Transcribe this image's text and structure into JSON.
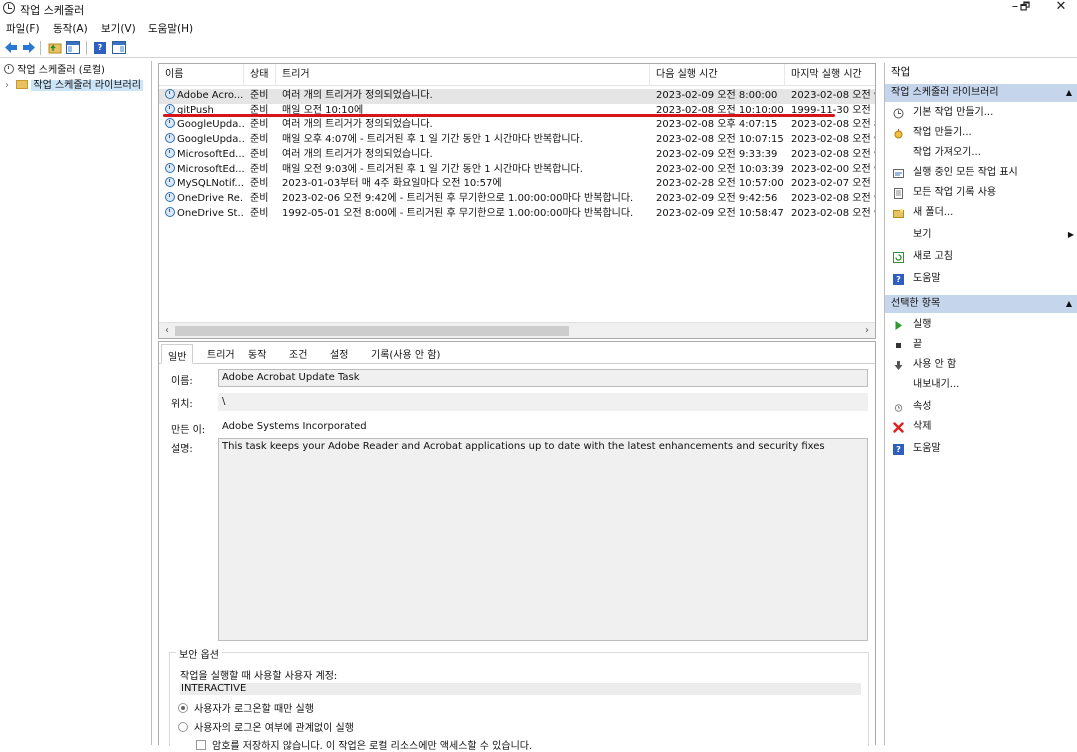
{
  "window": {
    "title": "작업 스케줄러",
    "minimize": "–",
    "maximize": "🗗",
    "close": "✕"
  },
  "menu": [
    "파일(F)",
    "동작(A)",
    "보기(V)",
    "도움말(H)"
  ],
  "tree": {
    "root": "작업 스케줄러 (로컬)",
    "child": "작업 스케줄러 라이브러리"
  },
  "grid": {
    "columns": [
      "이름",
      "상태",
      "트리거",
      "다음 실행 시간",
      "마지막 실행 시간"
    ],
    "rows": [
      [
        "Adobe Acro...",
        "준비",
        "여러 개의 트리거가 정의되었습니다.",
        "2023-02-09 오전 8:00:00",
        "2023-02-08 오전 9:"
      ],
      [
        "gitPush",
        "준비",
        "매일 오전 10:10에",
        "2023-02-08 오전 10:10:00",
        "1999-11-30 오전 1"
      ],
      [
        "GoogleUpda...",
        "준비",
        "여러 개의 트리거가 정의되었습니다.",
        "2023-02-08 오후 4:07:15",
        "2023-02-08 오전 8"
      ],
      [
        "GoogleUpda...",
        "준비",
        "매일 오후 4:07에 - 트리거된 후 1 일 기간 동안 1 시간마다 반복합니다.",
        "2023-02-08 오전 10:07:15",
        "2023-02-08 오전 9"
      ],
      [
        "MicrosoftEd...",
        "준비",
        "여러 개의 트리거가 정의되었습니다.",
        "2023-02-09 오전 9:33:39",
        "2023-02-08 오전 9"
      ],
      [
        "MicrosoftEd...",
        "준비",
        "매일 오전 9:03에 - 트리거된 후 1 일 기간 동안 1 시간마다 반복합니다.",
        "2023-02-00 오전 10:03:39",
        "2023-02-00 오전 9"
      ],
      [
        "MySQLNotif...",
        "준비",
        "2023-01-03부터 매 4주 화요일마다 오전 10:57에",
        "2023-02-28 오전 10:57:00",
        "2023-02-07 오전 1"
      ],
      [
        "OneDrive Re...",
        "준비",
        "2023-02-06 오전 9:42에 - 트리거된 후 무기한으로 1.00:00:00마다 반복합니다.",
        "2023-02-09 오전 9:42:56",
        "2023-02-08 오전 9"
      ],
      [
        "OneDrive St...",
        "준비",
        "1992-05-01 오전 8:00에 - 트리거된 후 무기한으로 1.00:00:00마다 반복합니다.",
        "2023-02-09 오전 10:58:47",
        "2023-02-08 오전 9"
      ]
    ]
  },
  "details": {
    "tabs": [
      "일반",
      "트리거",
      "동작",
      "조건",
      "설정",
      "기록(사용 안 함)"
    ],
    "name_label": "이름:",
    "name_value": "Adobe Acrobat Update Task",
    "location_label": "위치:",
    "location_value": "\\",
    "author_label": "만든 이:",
    "author_value": "Adobe Systems Incorporated",
    "desc_label": "설명:",
    "desc_value": "This task keeps your Adobe Reader and Acrobat applications up to date with the latest enhancements and security fixes",
    "security_title": "보안 옵션",
    "account_label": "작업을 실행할 때 사용할 사용자 계정:",
    "account_value": "INTERACTIVE",
    "radio1": "사용자가 로그온할 때만 실행",
    "radio2": "사용자의 로그온 여부에 관계없이 실행",
    "check1": "암호를 저장하지 않습니다. 이 작업은 로컬 리소스에만 액세스할 수 있습니다."
  },
  "actions": {
    "header": "작업",
    "section1": "작업 스케줄러 라이브러리",
    "items1": [
      "기본 작업 만들기...",
      "작업 만들기...",
      "작업 가져오기...",
      "실행 중인 모든 작업 표시",
      "모든 작업 기록 사용",
      "새 폴더...",
      "보기",
      "새로 고침",
      "도움말"
    ],
    "section2": "선택한 항목",
    "items2": [
      "실행",
      "끝",
      "사용 안 함",
      "내보내기...",
      "속성",
      "삭제",
      "도움말"
    ]
  }
}
